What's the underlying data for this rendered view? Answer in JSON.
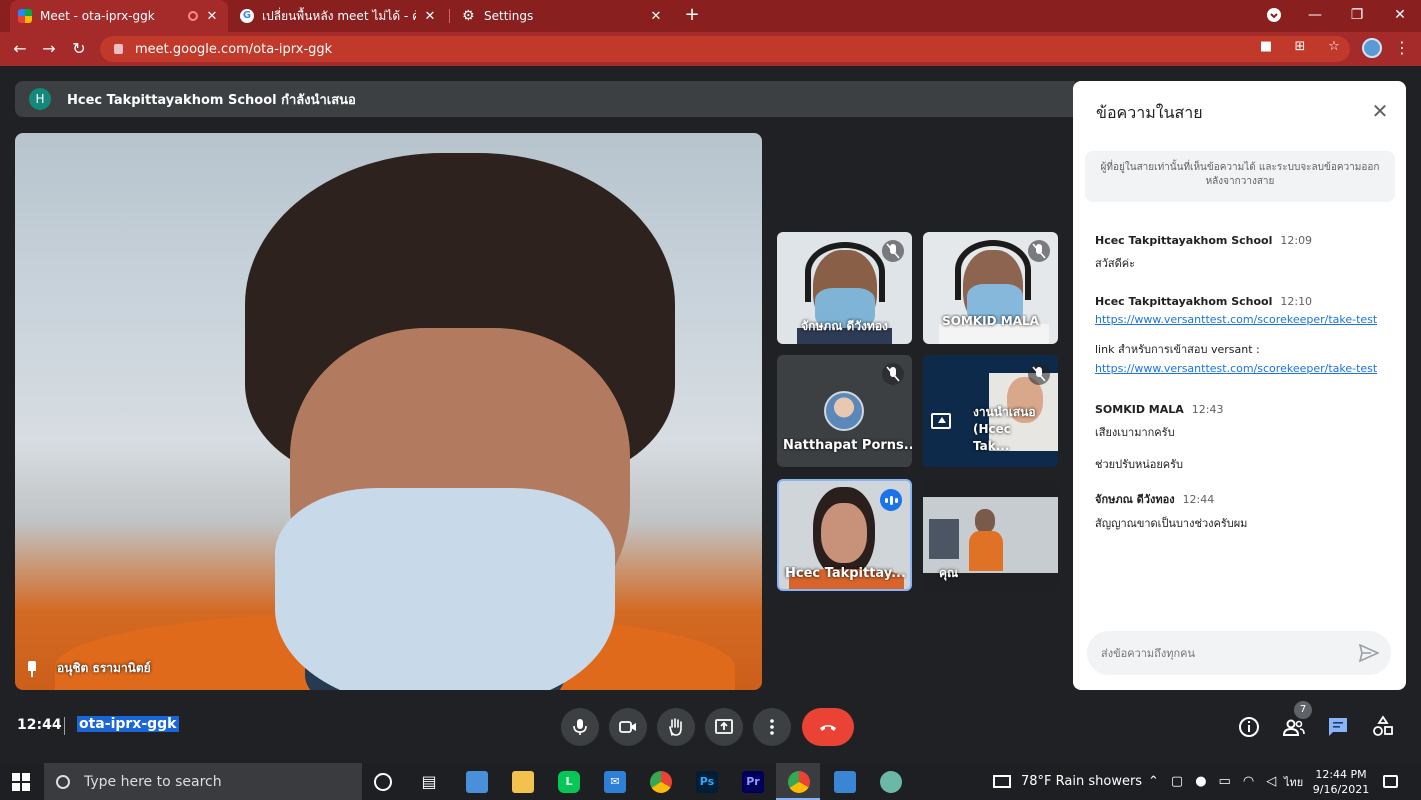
{
  "browser": {
    "tabs": [
      {
        "title": "Meet - ota-iprx-ggk",
        "active": true
      },
      {
        "title": "เปลี่ยนพื้นหลัง meet ไม่ได้ - ค้นหาด้วย Google",
        "active": false
      },
      {
        "title": "Settings",
        "active": false
      }
    ],
    "url": "meet.google.com/ota-iprx-ggk"
  },
  "meet": {
    "presenting_avatar": "H",
    "presenting_text": "Hcec Takpittayakhom School กำลังนำเสนอ",
    "main_speaker": "อนุชิต ธรามานิตย์",
    "tiles": [
      {
        "name": "จักษภณ ดีวังทอง",
        "muted": true
      },
      {
        "name": "SOMKID MALA",
        "muted": true
      },
      {
        "name": "Natthapat Porns...",
        "muted": true
      },
      {
        "name": "งานนำเสนอ (Hcec Tak...",
        "muted": true
      },
      {
        "name": "Hcec Takpittay...",
        "speaking": true
      },
      {
        "name": "คุณ",
        "muted": false
      }
    ],
    "clock": "12:44",
    "meeting_code": "ota-iprx-ggk",
    "participants_count": "7"
  },
  "chat": {
    "title": "ข้อความในสาย",
    "note": "ผู้ที่อยู่ในสายเท่านั้นที่เห็นข้อความได้ และระบบจะลบข้อความออกหลังจากวางสาย",
    "messages": [
      {
        "sender": "Hcec Takpittayakhom School",
        "time": "12:09",
        "lines": [
          "สวัสดีค่ะ"
        ]
      },
      {
        "sender": "Hcec Takpittayakhom School",
        "time": "12:10",
        "link1": "https://www.versanttest.com/scorekeeper/take-test",
        "line2": "link สำหรับการเข้าสอบ versant :",
        "link2": "https://www.versanttest.com/scorekeeper/take-test"
      },
      {
        "sender": "SOMKID MALA",
        "time": "12:43",
        "line1": "เสียงเบามากครับ",
        "line2": "ช่วยปรับหน่อยครับ"
      },
      {
        "sender": "จักษภณ ดีวังทอง",
        "time": "12:44",
        "line1": "สัญญาณขาดเป็นบางช่วงครับผม"
      }
    ],
    "input_placeholder": "ส่งข้อความถึงทุกคน"
  },
  "taskbar": {
    "search_placeholder": "Type here to search",
    "weather": "78°F  Rain showers",
    "lang": "ไทย",
    "time": "12:44 PM",
    "date": "9/16/2021"
  }
}
